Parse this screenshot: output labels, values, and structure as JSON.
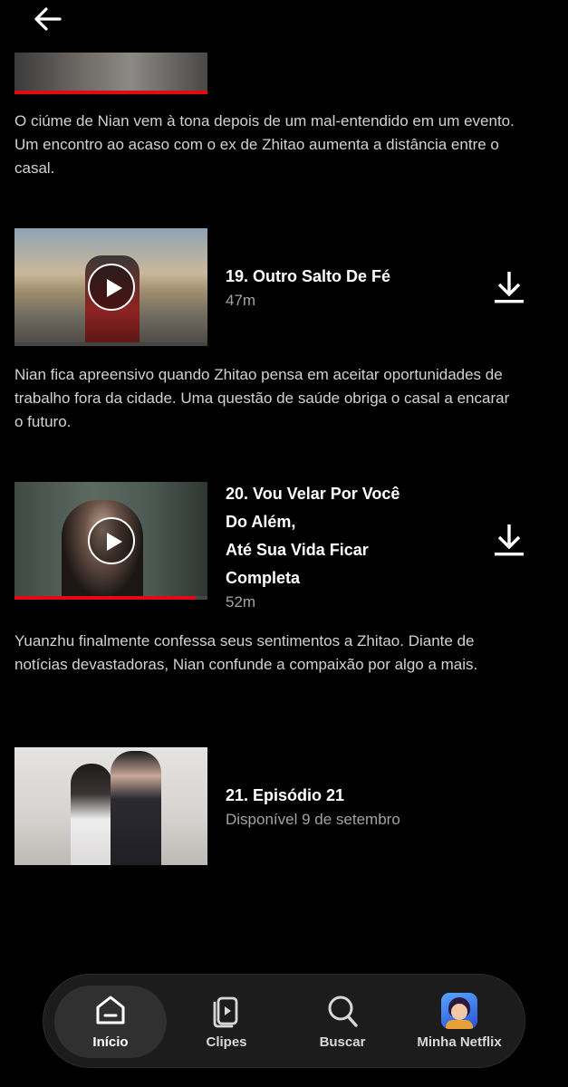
{
  "episode18": {
    "description": "O ciúme de Nian vem à tona depois de um mal-entendido em um evento. Um encontro ao acaso com o ex de Zhitao aumenta a distância entre o casal."
  },
  "episode19": {
    "title": "19. Outro Salto De Fé",
    "duration": "47m",
    "description": "Nian fica apreensivo quando Zhitao pensa em aceitar oportunidades de trabalho fora da cidade. Uma questão de saúde obriga o casal a encarar o futuro.",
    "progress": 0
  },
  "episode20": {
    "title_lines": [
      "20. Vou Velar Por Você",
      "Do Além,",
      "Até Sua Vida Ficar",
      "Completa"
    ],
    "duration": "52m",
    "description": "Yuanzhu finalmente confessa seus sentimentos a Zhitao. Diante de notícias devastadoras, Nian confunde a compaixão por algo a mais.",
    "progress": 0.94
  },
  "episode21": {
    "title": "21. Episódio 21",
    "availability": "Disponível 9 de setembro"
  },
  "nav": {
    "items": [
      {
        "label": "Início",
        "icon": "home-icon",
        "active": true
      },
      {
        "label": "Clipes",
        "icon": "clips-icon"
      },
      {
        "label": "Buscar",
        "icon": "search-icon"
      },
      {
        "label": "Minha Netflix",
        "icon": "profile-avatar"
      }
    ]
  },
  "colors": {
    "accent": "#e50914",
    "background": "#000000",
    "secondary_text": "#a3a3a3"
  }
}
